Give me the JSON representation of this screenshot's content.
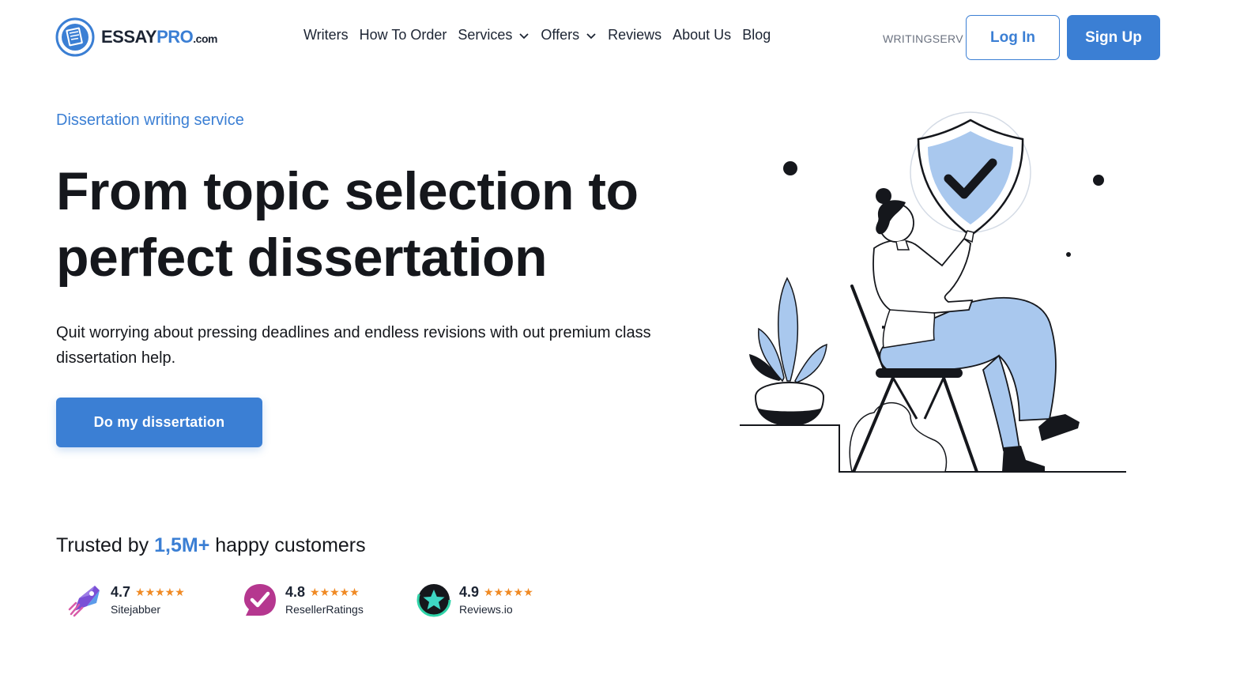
{
  "header": {
    "logo": {
      "brand": "ESSAY",
      "brand_accent": "PRO",
      "tld": ".com"
    },
    "nav": [
      {
        "label": "Writers",
        "dropdown": false
      },
      {
        "label": "How To Order",
        "dropdown": false
      },
      {
        "label": "Services",
        "dropdown": true
      },
      {
        "label": "Offers",
        "dropdown": true
      },
      {
        "label": "Reviews",
        "dropdown": false
      },
      {
        "label": "About Us",
        "dropdown": false
      },
      {
        "label": "Blog",
        "dropdown": false
      }
    ],
    "promo_code": "WRITINGSERV",
    "login_label": "Log In",
    "signup_label": "Sign Up"
  },
  "hero": {
    "eyebrow": "Dissertation writing service",
    "title_line1": "From topic selection to",
    "title_line2": "perfect dissertation",
    "subtitle": "Quit worrying about pressing deadlines and endless revisions with out premium class dissertation help.",
    "cta_label": "Do my dissertation"
  },
  "trust": {
    "prefix": "Trusted by ",
    "highlight": "1,5M+",
    "suffix": " happy customers"
  },
  "ratings": [
    {
      "score": "4.7",
      "site": "Sitejabber",
      "stars": "★★★★★",
      "icon": "sitejabber-icon"
    },
    {
      "score": "4.8",
      "site": "ResellerRatings",
      "stars": "★★★★★",
      "icon": "resellerratings-icon"
    },
    {
      "score": "4.9",
      "site": "Reviews.io",
      "stars": "★★★★★",
      "icon": "reviewsio-icon"
    }
  ],
  "colors": {
    "accent": "#3b7fd4",
    "star": "#f08a24",
    "illustration_fill": "#a9c8ee",
    "text": "#15171c"
  }
}
